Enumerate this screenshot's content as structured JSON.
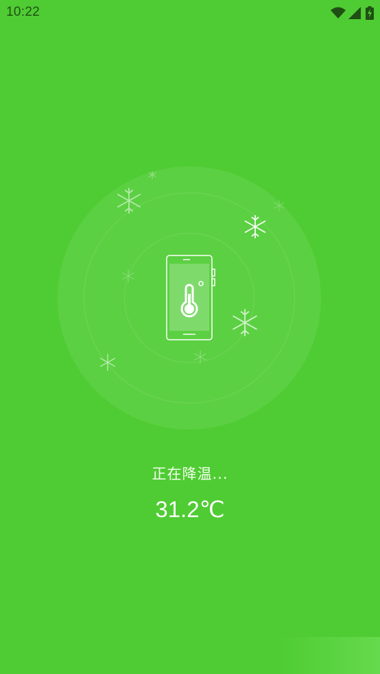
{
  "status_bar": {
    "time": "10:22",
    "icons": [
      "wifi-icon",
      "cell-signal-icon",
      "battery-charging-icon"
    ]
  },
  "cooling": {
    "status_label": "正在降温...",
    "temperature": "31.2℃"
  },
  "colors": {
    "background": "#4fcc33",
    "text": "#ffffff",
    "status_text": "#1f4f14"
  }
}
